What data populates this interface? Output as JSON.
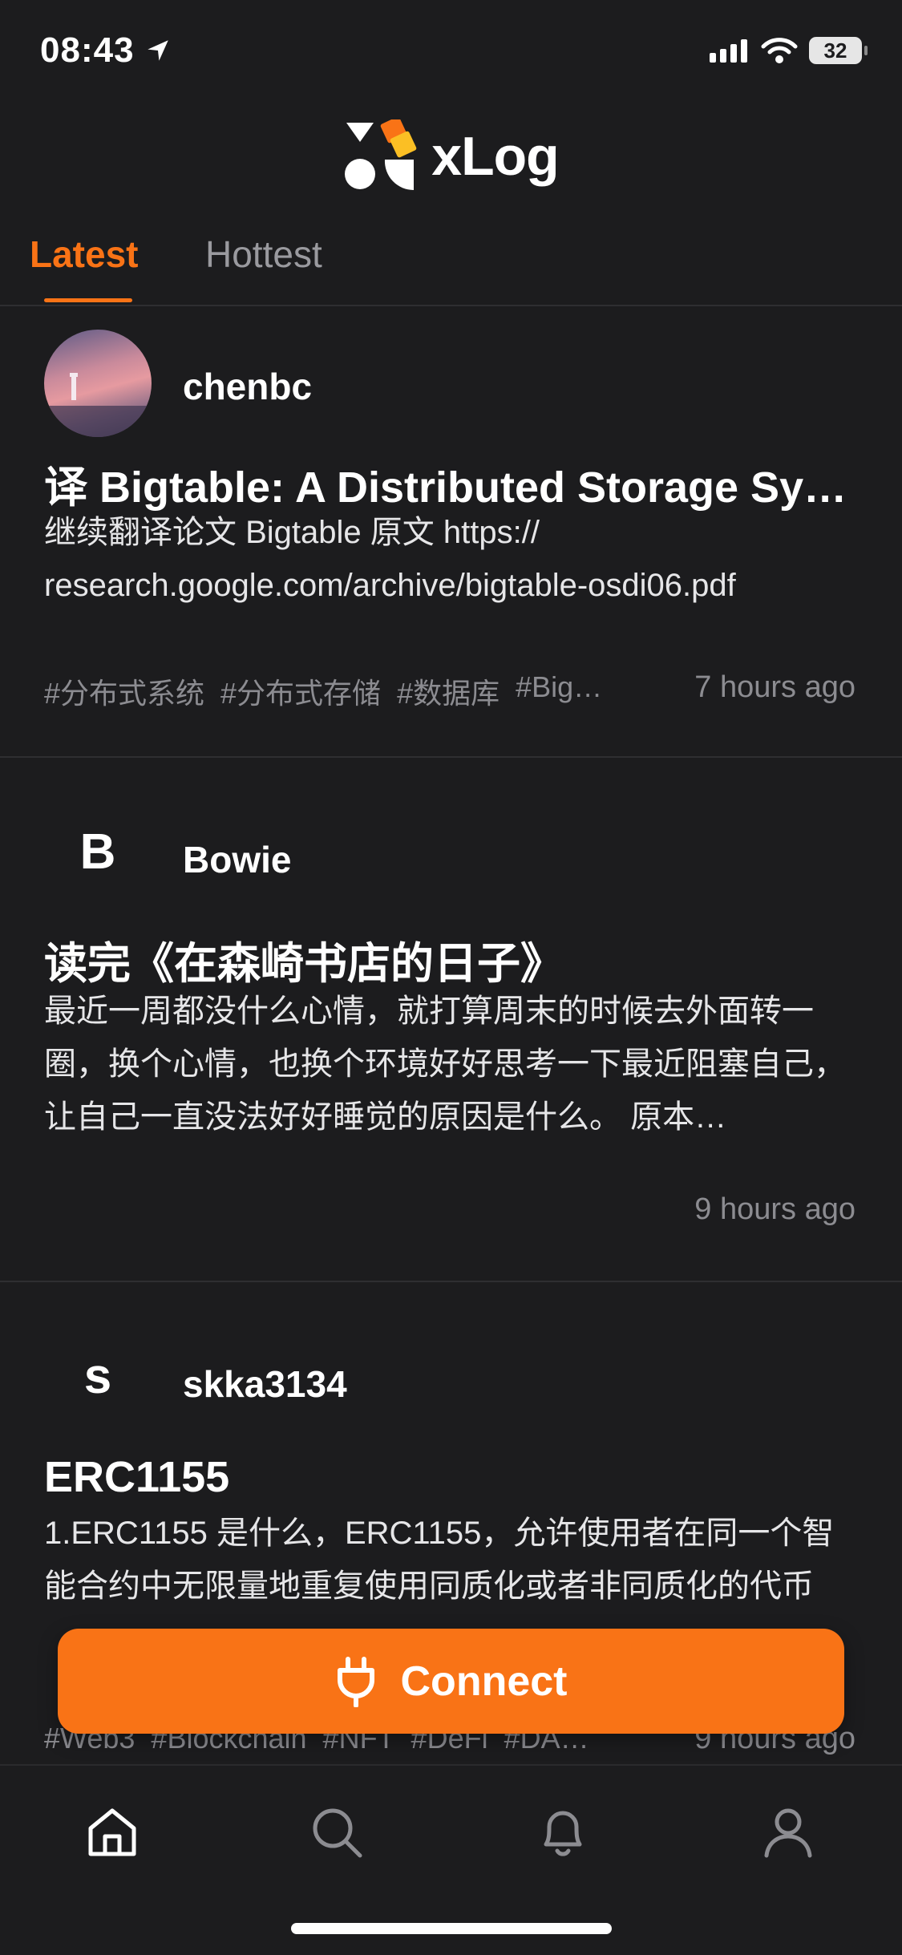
{
  "status_bar": {
    "time": "08:43",
    "battery": "32"
  },
  "header": {
    "app_name": "xLog"
  },
  "tabs": [
    {
      "label": "Latest",
      "active": true
    },
    {
      "label": "Hottest",
      "active": false
    }
  ],
  "posts": [
    {
      "author": "chenbc",
      "avatar_letter": "",
      "title": "译 Bigtable: A Distributed Storage Sy…",
      "excerpt": "继续翻译论文 Bigtable 原文 https:// research.google.com/archive/bigtable-osdi06.pdf",
      "tags": [
        "#分布式系统",
        "#分布式存储",
        "#数据库",
        "#Big…"
      ],
      "time": "7 hours ago"
    },
    {
      "author": "Bowie",
      "avatar_letter": "B",
      "title": "读完《在森崎书店的日子》",
      "excerpt": "最近一周都没什么心情，就打算周末的时候去外面转一圈，换个心情，也换个环境好好思考一下最近阻塞自己，让自己一直没法好好睡觉的原因是什么。 原本…",
      "tags": [],
      "time": "9 hours ago"
    },
    {
      "author": "skka3134",
      "avatar_letter": "s",
      "title": "ERC1155",
      "excerpt": "1.ERC1155 是什么，ERC1155，允许使用者在同一个智能合约中无限量地重复使用同质化或者非同质化的代币",
      "tags": [
        "#Web3",
        "#Blockchain",
        "#NFT",
        "#DeFi",
        "#DA…"
      ],
      "time": "9 hours ago"
    }
  ],
  "connect_button": {
    "label": "Connect"
  },
  "colors": {
    "accent": "#f97316",
    "background": "#1c1c1e",
    "muted": "#8c8c91"
  },
  "tabbar_icons": [
    "home-icon",
    "search-icon",
    "bell-icon",
    "profile-icon"
  ]
}
